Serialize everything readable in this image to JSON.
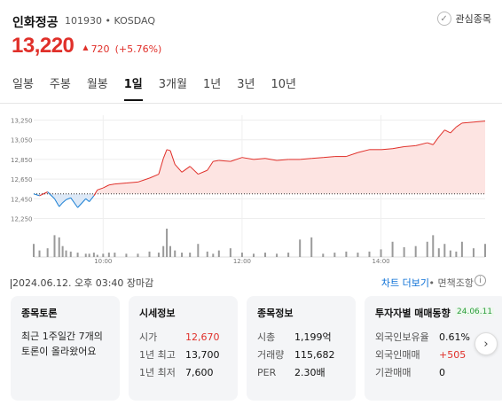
{
  "stock": {
    "name": "인화정공",
    "code_market": "101930 • KOSDAQ",
    "price": "13,220",
    "change": "720",
    "change_rate": "(+5.76%)"
  },
  "favorite_label": "관심종목",
  "tabs": [
    "일봉",
    "주봉",
    "월봉",
    "1일",
    "3개월",
    "1년",
    "3년",
    "10년"
  ],
  "active_tab": "1일",
  "chart_data": {
    "type": "area",
    "title": "",
    "xlabel": "",
    "ylabel": "",
    "ylim": [
      12200,
      13300
    ],
    "y_ticks": [
      12250,
      12450,
      12650,
      12850,
      13050,
      13250
    ],
    "y_tick_labels": [
      "12,250",
      "12,450",
      "12,650",
      "12,850",
      "13,050",
      "13,250"
    ],
    "x_tick_labels": [
      "10:00",
      "12:00",
      "14:00"
    ],
    "x_tick_times": [
      "10:00",
      "12:00",
      "14:00"
    ],
    "time_range": [
      "09:00",
      "15:30"
    ],
    "previous_close": 12500,
    "series": [
      {
        "x": [
          "09:00",
          "09:05",
          "09:12",
          "09:18",
          "09:22",
          "09:25",
          "09:28",
          "09:32",
          "09:38",
          "09:45",
          "09:48",
          "09:52",
          "09:55",
          "10:00",
          "10:05",
          "10:10",
          "10:20",
          "10:30",
          "10:40",
          "10:48",
          "10:52",
          "10:55",
          "10:58",
          "11:02",
          "11:08",
          "11:15",
          "11:22",
          "11:30",
          "11:35",
          "11:40",
          "11:50",
          "12:00",
          "12:10",
          "12:20",
          "12:30",
          "12:40",
          "12:50",
          "13:00",
          "13:10",
          "13:20",
          "13:30",
          "13:40",
          "13:50",
          "14:00",
          "14:10",
          "14:20",
          "14:30",
          "14:40",
          "14:45",
          "14:50",
          "14:55",
          "15:00",
          "15:05",
          "15:10",
          "15:20",
          "15:30"
        ],
        "values": [
          12500,
          12480,
          12520,
          12450,
          12370,
          12410,
          12440,
          12460,
          12360,
          12450,
          12420,
          12480,
          12540,
          12560,
          12590,
          12600,
          12610,
          12620,
          12660,
          12700,
          12860,
          12950,
          12940,
          12800,
          12720,
          12780,
          12700,
          12740,
          12830,
          12840,
          12830,
          12870,
          12850,
          12860,
          12840,
          12850,
          12850,
          12860,
          12870,
          12880,
          12880,
          12920,
          12950,
          12950,
          12960,
          12980,
          12990,
          13020,
          13000,
          13080,
          13150,
          13120,
          13180,
          13220,
          13230,
          13240
        ]
      }
    ],
    "volume": [
      12,
      6,
      8,
      20,
      18,
      10,
      6,
      5,
      4,
      3,
      3,
      4,
      2,
      3,
      4,
      4,
      3,
      3,
      5,
      4,
      10,
      26,
      10,
      6,
      4,
      4,
      12,
      5,
      3,
      6,
      8,
      4,
      3,
      4,
      3,
      4,
      16,
      18,
      3,
      4,
      5,
      4,
      5,
      7,
      14,
      9,
      10,
      14,
      20,
      8,
      12,
      6,
      5,
      14,
      8,
      12
    ],
    "grid": true
  },
  "timestamp": "2024.06.12. 오후 03:40 장마감",
  "chart_more_label": "차트 더보기",
  "disclaimer_label": "• 면책조항",
  "info_icon": "info-icon",
  "cards": {
    "discussion": {
      "title": "종목토론",
      "text": "최근 1주일간 7개의 토론이 올라왔어요"
    },
    "market": {
      "title": "시세정보",
      "rows": [
        {
          "k": "시가",
          "v": "12,670"
        },
        {
          "k": "1년 최고",
          "v": "13,700"
        },
        {
          "k": "1년 최저",
          "v": "7,600"
        }
      ]
    },
    "stockinfo": {
      "title": "종목정보",
      "rows": [
        {
          "k": "시총",
          "v": "1,199억"
        },
        {
          "k": "거래량",
          "v": "115,682"
        },
        {
          "k": "PER",
          "v": "2.30배"
        }
      ]
    },
    "investor": {
      "title": "투자자별 매매동향",
      "date": "24.06.11",
      "rows": [
        {
          "k": "외국인보유율",
          "v": "0.61%"
        },
        {
          "k": "외국인매매",
          "v": "+505"
        },
        {
          "k": "기관매매",
          "v": "0"
        }
      ]
    }
  },
  "colors": {
    "up": "#e0302a",
    "down": "#1a7fd4",
    "area_fill": "#fde4e2",
    "badge_green": "#2a9d3a"
  }
}
